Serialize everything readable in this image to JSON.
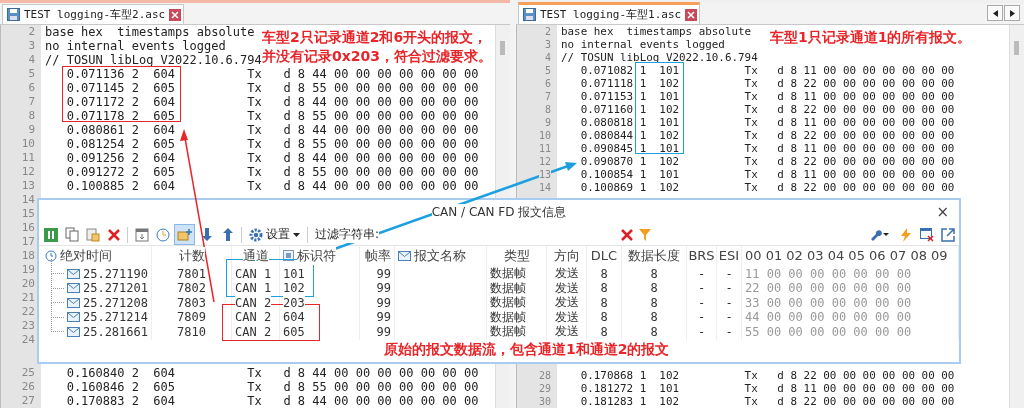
{
  "panes": [
    {
      "tab": {
        "title": "TEST logging-车型2.asc",
        "active": false
      },
      "top_lines": [
        {
          "number": "2",
          "text": "base hex  timestamps absolute"
        },
        {
          "number": "3",
          "text": "no internal events logged"
        },
        {
          "number": "4",
          "text": "// TOSUN libLog V2022.10.6.794"
        },
        {
          "number": "5",
          "text": "   0.071136 2  604          Tx   d 8 44 00 00 00 00 00 00 00"
        },
        {
          "number": "6",
          "text": "   0.071145 2  605          Tx   d 8 55 00 00 00 00 00 00 00"
        },
        {
          "number": "7",
          "text": "   0.071172 2  604          Tx   d 8 44 00 00 00 00 00 00 00"
        },
        {
          "number": "8",
          "text": "   0.071178 2  605          Tx   d 8 55 00 00 00 00 00 00 00"
        },
        {
          "number": "9",
          "text": "   0.080861 2  604          Tx   d 8 44 00 00 00 00 00 00 00"
        },
        {
          "number": "10",
          "text": "   0.081254 2  605          Tx   d 8 55 00 00 00 00 00 00 00"
        },
        {
          "number": "11",
          "text": "   0.091256 2  604          Tx   d 8 44 00 00 00 00 00 00 00"
        },
        {
          "number": "12",
          "text": "   0.091272 2  605          Tx   d 8 55 00 00 00 00 00 00 00"
        },
        {
          "number": "13",
          "text": "   0.100885 2  604          Tx   d 8 44 00 00 00 00 00 00 00"
        },
        {
          "number": "14"
        },
        {
          "number": "15"
        },
        {
          "number": "16"
        },
        {
          "number": "17"
        },
        {
          "number": "18"
        },
        {
          "number": "19"
        },
        {
          "number": "20"
        },
        {
          "number": "21"
        },
        {
          "number": "22"
        },
        {
          "number": "23"
        },
        {
          "number": "24"
        }
      ],
      "bottom_lines": [
        {
          "number": "25",
          "text": "   0.160840 2  604          Tx   d 8 44 00 00 00 00 00 00 00"
        },
        {
          "number": "26",
          "text": "   0.160846 2  605          Tx   d 8 55 00 00 00 00 00 00 00"
        },
        {
          "number": "27",
          "text": "   0.170883 2  604          Tx   d 8 44 00 00 00 00 00 00 00"
        }
      ]
    },
    {
      "tab": {
        "title": "TEST logging-车型1.asc",
        "active": true
      },
      "top_lines": [
        {
          "number": "2",
          "text": "base hex  timestamps absolute"
        },
        {
          "number": "3",
          "text": "no internal events logged"
        },
        {
          "number": "4",
          "text": "// TOSUN libLog V2022.10.6.794"
        },
        {
          "number": "5",
          "text": "   0.071082 1  101          Tx   d 8 11 00 00 00 00 00 00 00"
        },
        {
          "number": "6",
          "text": "   0.071118 1  102          Tx   d 8 22 00 00 00 00 00 00 00"
        },
        {
          "number": "7",
          "text": "   0.071153 1  101          Tx   d 8 11 00 00 00 00 00 00 00"
        },
        {
          "number": "8",
          "text": "   0.071160 1  102          Tx   d 8 22 00 00 00 00 00 00 00"
        },
        {
          "number": "9",
          "text": "   0.080818 1  101          Tx   d 8 11 00 00 00 00 00 00 00"
        },
        {
          "number": "10",
          "text": "   0.080844 1  102          Tx   d 8 22 00 00 00 00 00 00 00"
        },
        {
          "number": "11",
          "text": "   0.090845 1  101          Tx   d 8 11 00 00 00 00 00 00 00"
        },
        {
          "number": "12",
          "text": "   0.090870 1  102          Tx   d 8 22 00 00 00 00 00 00 00"
        },
        {
          "number": "13",
          "text": "   0.100854 1  101          Tx   d 8 11 00 00 00 00 00 00 00"
        },
        {
          "number": "14",
          "text": "   0.100869 1  102          Tx   d 8 22 00 00 00 00 00 00 00"
        }
      ],
      "bottom_lines": [
        {
          "number": "28",
          "text": "   0.170868 1  102          Tx   d 8 22 00 00 00 00 00 00 00"
        },
        {
          "number": "29",
          "text": "   0.181272 1  101          Tx   d 8 11 00 00 00 00 00 00 00"
        },
        {
          "number": "30",
          "text": "   0.181283 1  102          Tx   d 8 22 00 00 00 00 00 00 00"
        }
      ]
    }
  ],
  "notes": {
    "left": [
      "车型2只记录通道2和6开头的报文，",
      "并没有记录0x203，符合过滤要求。"
    ],
    "right": "车型1只记录通道1的所有报文。",
    "dialog": "原始的报文数据流，包含通道1和通道2的报文"
  },
  "dialog": {
    "title": "CAN / CAN FD 报文信息",
    "close": "×",
    "toolbar": [
      {
        "kind": "pause",
        "selected": false
      },
      {
        "kind": "copy",
        "selected": false
      },
      {
        "kind": "paste",
        "selected": false
      },
      {
        "kind": "delete",
        "selected": false
      },
      {
        "kind": "sep"
      },
      {
        "kind": "panel",
        "selected": false
      },
      {
        "kind": "clock",
        "selected": false
      },
      {
        "kind": "scroll",
        "selected": true
      },
      {
        "kind": "down",
        "selected": false
      },
      {
        "kind": "up",
        "selected": false
      },
      {
        "kind": "sep"
      }
    ],
    "settings": "设置",
    "filter_label": "过滤字符串:",
    "columns": [
      "绝对时间",
      "计数",
      "通道",
      "标识符",
      "帧率",
      "报文名称",
      "类型",
      "方向",
      "DLC",
      "数据长度",
      "BRS",
      "ESI",
      "00 01 02 03 04 05 06 07 08 09"
    ],
    "rows": [
      {
        "time": "25.271190",
        "count": "7801",
        "channel": "CAN 1",
        "id": "101",
        "rate": "99",
        "type": "数据帧",
        "direction": "发送",
        "dlc": "8",
        "length": "8",
        "brs": "-",
        "esi": "-",
        "data": "11 00 00 00 00 00 00 00"
      },
      {
        "time": "25.271201",
        "count": "7802",
        "channel": "CAN 1",
        "id": "102",
        "rate": "99",
        "type": "数据帧",
        "direction": "发送",
        "dlc": "8",
        "length": "8",
        "brs": "-",
        "esi": "-",
        "data": "22 00 00 00 00 00 00 00"
      },
      {
        "time": "25.271208",
        "count": "7803",
        "channel": "CAN 2",
        "id": "203",
        "rate": "99",
        "type": "数据帧",
        "direction": "发送",
        "dlc": "8",
        "length": "8",
        "brs": "-",
        "esi": "-",
        "data": "33 00 00 00 00 00 00 00"
      },
      {
        "time": "25.271214",
        "count": "7809",
        "channel": "CAN 2",
        "id": "604",
        "rate": "99",
        "type": "数据帧",
        "direction": "发送",
        "dlc": "8",
        "length": "8",
        "brs": "-",
        "esi": "-",
        "data": "44 00 00 00 00 00 00 00"
      },
      {
        "time": "25.281661",
        "count": "7810",
        "channel": "CAN 2",
        "id": "605",
        "rate": "99",
        "type": "数据帧",
        "direction": "发送",
        "dlc": "8",
        "length": "8",
        "brs": "-",
        "esi": "-",
        "data": "55 00 00 00 00 00 00 00"
      }
    ]
  }
}
